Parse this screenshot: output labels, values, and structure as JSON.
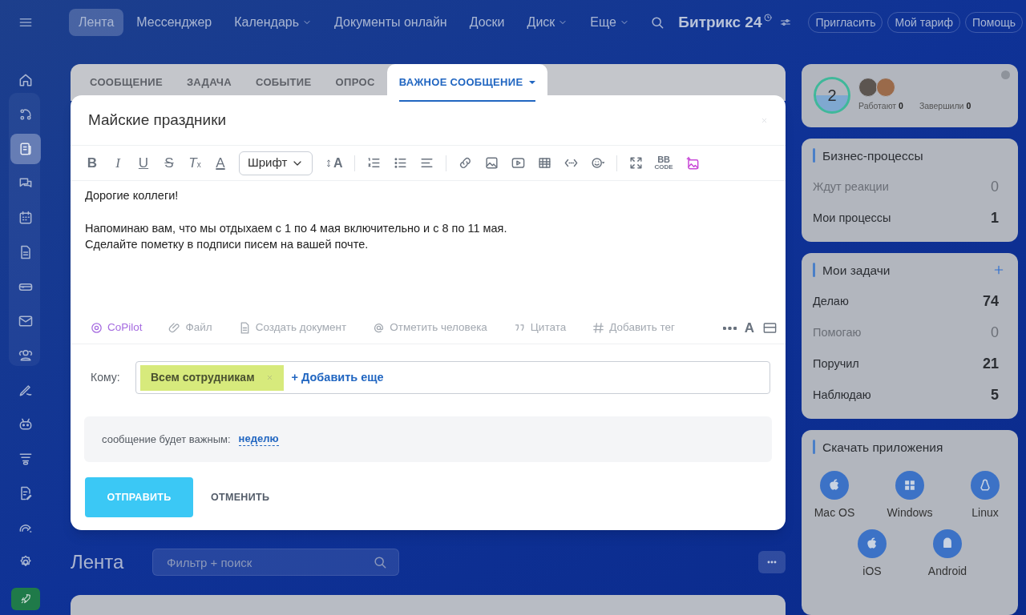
{
  "top_nav": {
    "items": [
      {
        "label": "Лента",
        "selected": true,
        "dropdown": false
      },
      {
        "label": "Мессенджер",
        "selected": false,
        "dropdown": false
      },
      {
        "label": "Календарь",
        "selected": false,
        "dropdown": true
      },
      {
        "label": "Документы онлайн",
        "selected": false,
        "dropdown": false
      },
      {
        "label": "Доски",
        "selected": false,
        "dropdown": false
      },
      {
        "label": "Диск",
        "selected": false,
        "dropdown": true
      },
      {
        "label": "Еще",
        "selected": false,
        "dropdown": true
      }
    ],
    "brand": "Битрикс 24",
    "buttons": [
      "Пригласить",
      "Мой тариф",
      "Помощь"
    ]
  },
  "sidebar": {
    "items": [
      {
        "kind": "nav",
        "selected": false
      },
      {
        "kind": "nav",
        "selected": false
      },
      {
        "kind": "nav",
        "selected": true
      },
      {
        "kind": "nav",
        "selected": false
      },
      {
        "kind": "nav",
        "selected": false
      },
      {
        "kind": "nav",
        "selected": false
      },
      {
        "kind": "nav",
        "selected": false
      },
      {
        "kind": "nav",
        "selected": false
      },
      {
        "kind": "nav",
        "selected": false
      },
      {
        "kind": "nav",
        "selected": false
      },
      {
        "kind": "nav",
        "selected": false
      },
      {
        "kind": "nav",
        "selected": false
      },
      {
        "kind": "nav",
        "selected": false
      },
      {
        "kind": "nav",
        "selected": false
      },
      {
        "kind": "nav",
        "selected": false
      },
      {
        "kind": "launch"
      }
    ]
  },
  "composer": {
    "tabs": [
      {
        "label": "СООБЩЕНИЕ",
        "selected": false,
        "dropdown": false
      },
      {
        "label": "ЗАДАЧА",
        "selected": false,
        "dropdown": false
      },
      {
        "label": "СОБЫТИЕ",
        "selected": false,
        "dropdown": false
      },
      {
        "label": "ОПРОС",
        "selected": false,
        "dropdown": false
      },
      {
        "label": "ВАЖНОЕ СООБЩЕНИЕ",
        "selected": true,
        "dropdown": true
      }
    ],
    "title": "Майские праздники",
    "format_buttons": [
      {
        "kind": "bold",
        "label": "B"
      },
      {
        "kind": "italic",
        "label": "I"
      },
      {
        "kind": "underline",
        "label": "U"
      },
      {
        "kind": "strike",
        "label": "S"
      },
      {
        "kind": "clear",
        "label": "T",
        "subscript": "x"
      },
      {
        "kind": "color",
        "label": "A"
      }
    ],
    "font_select": "Шрифт",
    "size_button": "A",
    "bbcode": [
      "BB",
      "CODE"
    ],
    "body": [
      "Дорогие коллеги!",
      "Напоминаю вам, что мы отдыхаем с 1 по 4 мая включительно и с 8 по 11 мая.\nСделайте пометку в подписи писем на вашей почте."
    ],
    "actions": [
      {
        "kind": "copilot",
        "label": "CoPilot"
      },
      {
        "kind": "plain",
        "label": "Файл"
      },
      {
        "kind": "plain",
        "label": "Создать документ"
      },
      {
        "kind": "plain",
        "label": "Отметить человека"
      },
      {
        "kind": "plain",
        "label": "Цитата"
      },
      {
        "kind": "plain",
        "label": "Добавить тег"
      }
    ],
    "format_toggle": "A",
    "recipients": {
      "label": "Кому:",
      "chips": [
        "Всем сотрудникам"
      ],
      "add": "+ Добавить еще"
    },
    "importance": {
      "text": "сообщение будет важным:",
      "link": "неделю"
    },
    "send": "ОТПРАВИТЬ",
    "cancel": "ОТМЕНИТЬ"
  },
  "feed": {
    "title": "Лента",
    "filter": {
      "placeholder": "Фильтр + поиск"
    }
  },
  "pulse": {
    "count": "2",
    "stats": [
      {
        "label": "Работают",
        "value": "0"
      },
      {
        "label": "Завершили",
        "value": "0"
      }
    ]
  },
  "business_processes": {
    "title": "Бизнес-процессы",
    "rows": [
      {
        "label": "Ждут реакции",
        "value": "0",
        "muted": true
      },
      {
        "label": "Мои процессы",
        "value": "1",
        "muted": false
      }
    ]
  },
  "tasks": {
    "title": "Мои задачи",
    "rows": [
      {
        "label": "Делаю",
        "value": "74",
        "muted": false
      },
      {
        "label": "Помогаю",
        "value": "0",
        "muted": true
      },
      {
        "label": "Поручил",
        "value": "21",
        "muted": false
      },
      {
        "label": "Наблюдаю",
        "value": "5",
        "muted": false
      }
    ]
  },
  "apps": {
    "title": "Скачать приложения",
    "items": [
      {
        "label": "Mac OS",
        "kind": "apple"
      },
      {
        "label": "Windows",
        "kind": "windows"
      },
      {
        "label": "Linux",
        "kind": "linux"
      },
      {
        "label": "iOS",
        "kind": "apple"
      },
      {
        "label": "Android",
        "kind": "android"
      }
    ]
  }
}
